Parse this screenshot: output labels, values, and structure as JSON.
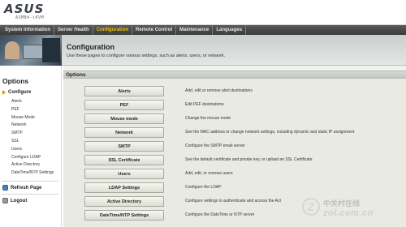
{
  "header": {
    "logo_text": "ASUS",
    "logo_sub": "ASMB4-iKVM"
  },
  "topnav": {
    "tabs": [
      {
        "label": "System Information",
        "active": false
      },
      {
        "label": "Server Health",
        "active": false
      },
      {
        "label": "Configuration",
        "active": true
      },
      {
        "label": "Remote Control",
        "active": false
      },
      {
        "label": "Maintenance",
        "active": false
      },
      {
        "label": "Languages",
        "active": false
      }
    ]
  },
  "banner": {
    "title": "Configuration",
    "description": "Use these pages to configure various settings, such as alerts, users, or network."
  },
  "sidebar": {
    "heading": "Options",
    "section": "Configure",
    "items": [
      "Alerts",
      "PEF",
      "Mouse Mode",
      "Network",
      "SMTP",
      "SSL",
      "Users",
      "Configure LDAP",
      "Active Directory",
      "DateTime/NTP Settings"
    ],
    "refresh": "Refresh Page",
    "logout": "Logout"
  },
  "main": {
    "options_title": "Options",
    "rows": [
      {
        "button": "Alerts",
        "desc": "Add, edit or remove alert destinations"
      },
      {
        "button": "PEF",
        "desc": "Edit PEF destinations"
      },
      {
        "button": "Mouse mode",
        "desc": "Change the mouse mode"
      },
      {
        "button": "Network",
        "desc": "See the MAC address or change network settings, including dynamic and static IP assignment"
      },
      {
        "button": "SMTP",
        "desc": "Configure the SMTP email server"
      },
      {
        "button": "SSL Certificate",
        "desc": "See the default certificate and private key, or upload an SSL Certificate"
      },
      {
        "button": "Users",
        "desc": "Add, edit, or remove users"
      },
      {
        "button": "LDAP Settings",
        "desc": "Configure the LDAP"
      },
      {
        "button": "Active Directory",
        "desc": "Configure settings to authenticate and access the Act"
      },
      {
        "button": "DateTime/NTP Settings",
        "desc": "Configure the DateTime or NTP server"
      }
    ]
  },
  "watermark": {
    "mark": "Z",
    "cn": "中关村在线",
    "url": "zol.com.cn"
  },
  "colors": {
    "accent": "#f0c000",
    "nav_bg": "#3b3b3b",
    "panel": "#eaeae4"
  }
}
